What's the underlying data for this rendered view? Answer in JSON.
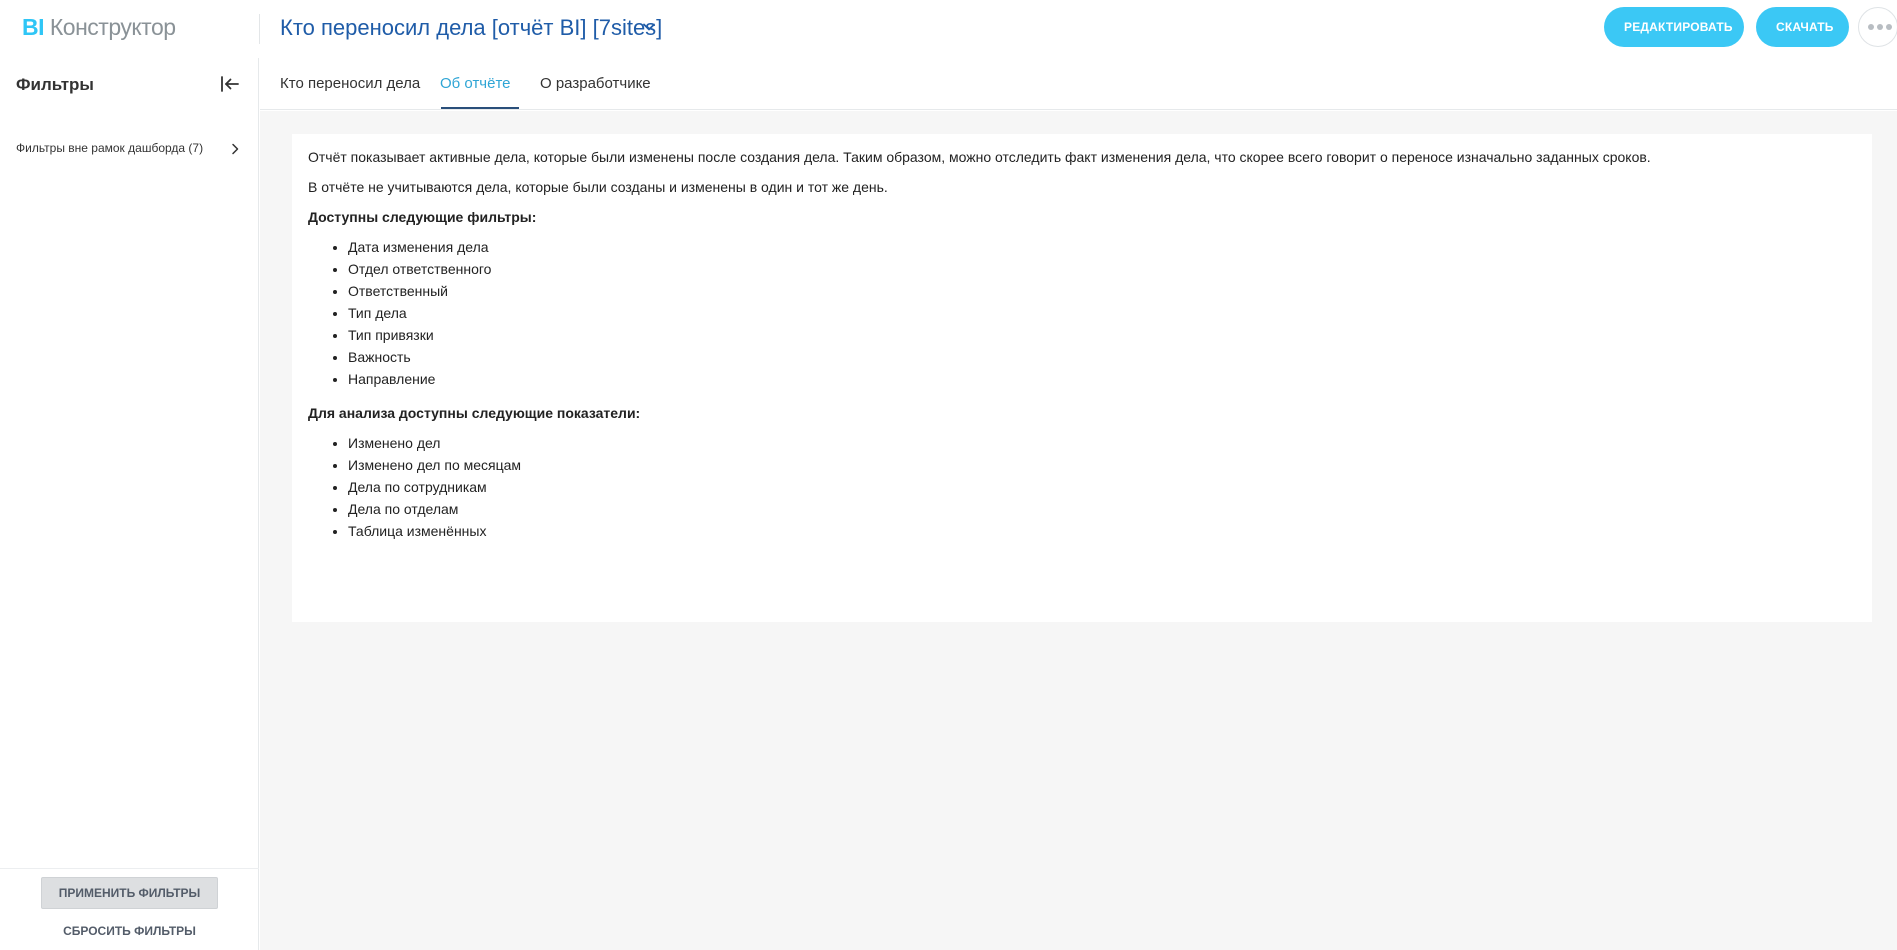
{
  "header": {
    "logo_bi": "BI",
    "logo_name": "Конструктор",
    "report_title": "Кто переносил дела [отчёт BI] [7sites]",
    "edit_label": "РЕДАКТИРОВАТЬ",
    "download_label": "СКАЧАТЬ"
  },
  "sidebar": {
    "title": "Фильтры",
    "filter_group_label": "Фильтры вне рамок дашборда (7)",
    "apply_label": "ПРИМЕНИТЬ ФИЛЬТРЫ",
    "reset_label": "СБРОСИТЬ ФИЛЬТРЫ"
  },
  "tabs": [
    {
      "label": "Кто переносил дела",
      "active": false
    },
    {
      "label": "Об отчёте",
      "active": true
    },
    {
      "label": "О разработчике",
      "active": false
    }
  ],
  "content": {
    "paragraph_1": "Отчёт показывает активные дела, которые были изменены после создания дела. Таким образом, можно отследить факт изменения дела, что скорее всего говорит о переносе изначально заданных сроков.",
    "paragraph_2": "В отчёте не учитываются дела, которые были созданы и изменены в один и тот же день.",
    "filters_heading": "Доступны следующие фильтры:",
    "filters": [
      "Дата изменения дела",
      "Отдел ответственного",
      "Ответственный",
      "Тип дела",
      "Тип привязки",
      "Важность",
      "Направление"
    ],
    "metrics_heading": "Для анализа доступны следующие показатели:",
    "metrics": [
      "Изменено дел",
      "Изменено дел по месяцам",
      "Дела по сотрудникам",
      "Дела по отделам",
      "Таблица изменённых"
    ]
  },
  "colors": {
    "accent": "#3bc8f5",
    "title_blue": "#1f5ca8",
    "active_tab": "#2fa5d5",
    "tab_underline": "#2a4f7a",
    "content_bg": "#f6f6f6"
  },
  "icons": {
    "title_dropdown": "chevron-down-icon",
    "more": "more-dots-icon",
    "collapse": "collapse-left-icon",
    "filter_group": "chevron-right-icon"
  }
}
